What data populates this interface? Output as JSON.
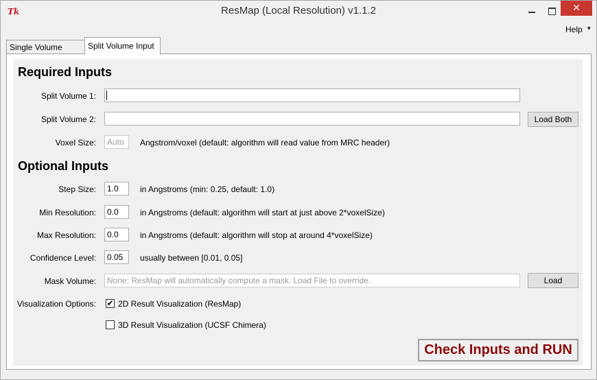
{
  "window": {
    "title": "ResMap (Local Resolution) v1.1.2",
    "icon": "tk-icon",
    "controls": {
      "minimize": "minimize-icon",
      "maximize": "maximize-icon",
      "close": "✕"
    }
  },
  "menu": {
    "help_label": "Help",
    "help_caret": "▾"
  },
  "tabs": [
    {
      "label": "Single Volume Input",
      "selected": false
    },
    {
      "label": "Split Volume Input",
      "selected": true
    }
  ],
  "required": {
    "heading": "Required Inputs",
    "split1_label": "Split Volume 1:",
    "split1_value": "",
    "split2_label": "Split Volume 2:",
    "split2_value": "",
    "load_both_label": "Load Both",
    "voxel_label": "Voxel Size:",
    "voxel_value": "Auto",
    "voxel_hint": "Angstrom/voxel (default: algorithm will read value from MRC header)"
  },
  "optional": {
    "heading": "Optional Inputs",
    "step_label": "Step Size:",
    "step_value": "1.0",
    "step_hint": "in Angstroms (min: 0.25, default: 1.0)",
    "minres_label": "Min Resolution:",
    "minres_value": "0.0",
    "minres_hint": "in Angstroms (default: algorithm will start at just above 2*voxelSize)",
    "maxres_label": "Max Resolution:",
    "maxres_value": "0.0",
    "maxres_hint": "in Angstroms (default: algorithm will stop at around 4*voxelSize)",
    "conf_label": "Confidence Level:",
    "conf_value": "0.05",
    "conf_hint": "usually between [0.01, 0.05]",
    "mask_label": "Mask Volume:",
    "mask_placeholder": "None; ResMap will automatically compute a mask. Load File to override.",
    "load_label": "Load",
    "vis_label": "Visualization Options:",
    "vis2d_label": "2D Result Visualization (ResMap)",
    "vis2d_checked": "✔",
    "vis3d_label": "3D Result Visualization (UCSF Chimera)",
    "vis3d_checked": ""
  },
  "run_label": "Check Inputs and RUN",
  "colors": {
    "run_text": "#8b0a0a",
    "close_button": "#c7372f"
  }
}
